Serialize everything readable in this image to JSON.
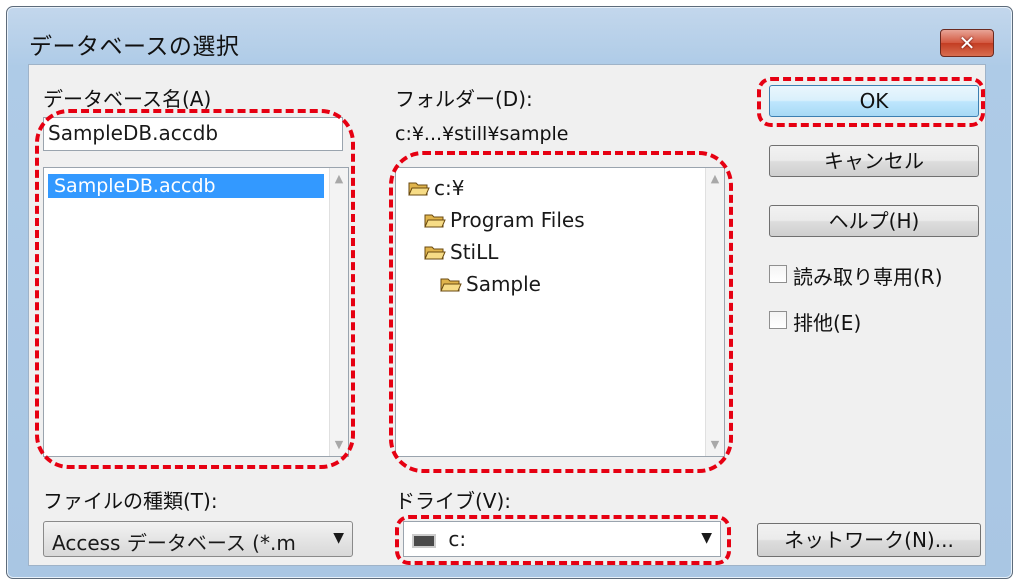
{
  "dialog": {
    "title": "データベースの選択",
    "close_icon": "✕"
  },
  "database_name": {
    "label": "データベース名(A)",
    "value": "SampleDB.accdb",
    "list_items": [
      "SampleDB.accdb"
    ]
  },
  "folder": {
    "label": "フォルダー(D):",
    "current_path": "c:¥...¥still¥sample",
    "tree": [
      "c:¥",
      "Program Files",
      "StiLL",
      "Sample"
    ]
  },
  "buttons": {
    "ok": "OK",
    "cancel": "キャンセル",
    "help": "ヘルプ(H)",
    "network": "ネットワーク(N)..."
  },
  "options": {
    "read_only": "読み取り専用(R)",
    "exclusive": "排他(E)"
  },
  "file_type": {
    "label": "ファイルの種類(T):",
    "selected": "Access データベース (*.m"
  },
  "drive": {
    "label": "ドライブ(V):",
    "selected": "c:"
  },
  "colors": {
    "highlight": "#e60012",
    "selection": "#3399ff"
  }
}
